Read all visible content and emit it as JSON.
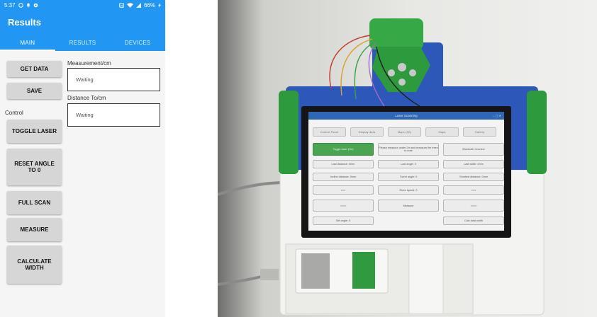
{
  "status_bar": {
    "time": "5:37",
    "left_icons": [
      "whatsapp-icon",
      "notification-icon",
      "app-icon"
    ],
    "right_icons": [
      "nfc-icon",
      "wifi-icon",
      "signal-icon"
    ],
    "battery": "66%"
  },
  "appbar": {
    "title": "Results"
  },
  "tabs": [
    {
      "label": "MAIN",
      "active": true
    },
    {
      "label": "RESULTS",
      "active": false
    },
    {
      "label": "DEVICES",
      "active": false
    }
  ],
  "main": {
    "get_data": "GET DATA",
    "save": "SAVE",
    "control_label": "Control",
    "toggle_laser": "TOGGLE LASER",
    "reset_angle": "RESET ANGLE TO 0",
    "full_scan": "FULL SCAN",
    "measure": "MEASURE",
    "calculate_width": "CALCULATE WIDTH",
    "measurement_label": "Measurement/cm",
    "measurement_value": "Waiting",
    "distance_label": "Distance To/cm",
    "distance_value": "Waiting"
  },
  "colors": {
    "accent": "#2196f3",
    "button": "#d6d6d6",
    "device_green": "#2e9a3e",
    "device_blue": "#2d57b8"
  },
  "device_screen": {
    "title": "Laser Scanning",
    "tabs": [
      "Control Panel",
      "Display data",
      "Maps (2D)",
      "Maps",
      "Gallery"
    ],
    "row1": [
      "Toggle laser (On)",
      "Please measure under 2m and measure the trees to note",
      "Bluetooth Connect"
    ],
    "row2": [
      "Last distance: 0mm",
      "Last angle: 0",
      "Last width: 0mm"
    ],
    "row3": [
      "Incline distance: 0mm",
      "Turret angle: 0",
      "Shortest distance: 0mm"
    ],
    "row4": [
      "<<<",
      "Rotor speed: 0",
      ">>>"
    ],
    "row5": [
      "<<<<",
      "Measure",
      ">>>>"
    ],
    "row6": [
      "Set angle: 0",
      "Calc data width"
    ]
  }
}
